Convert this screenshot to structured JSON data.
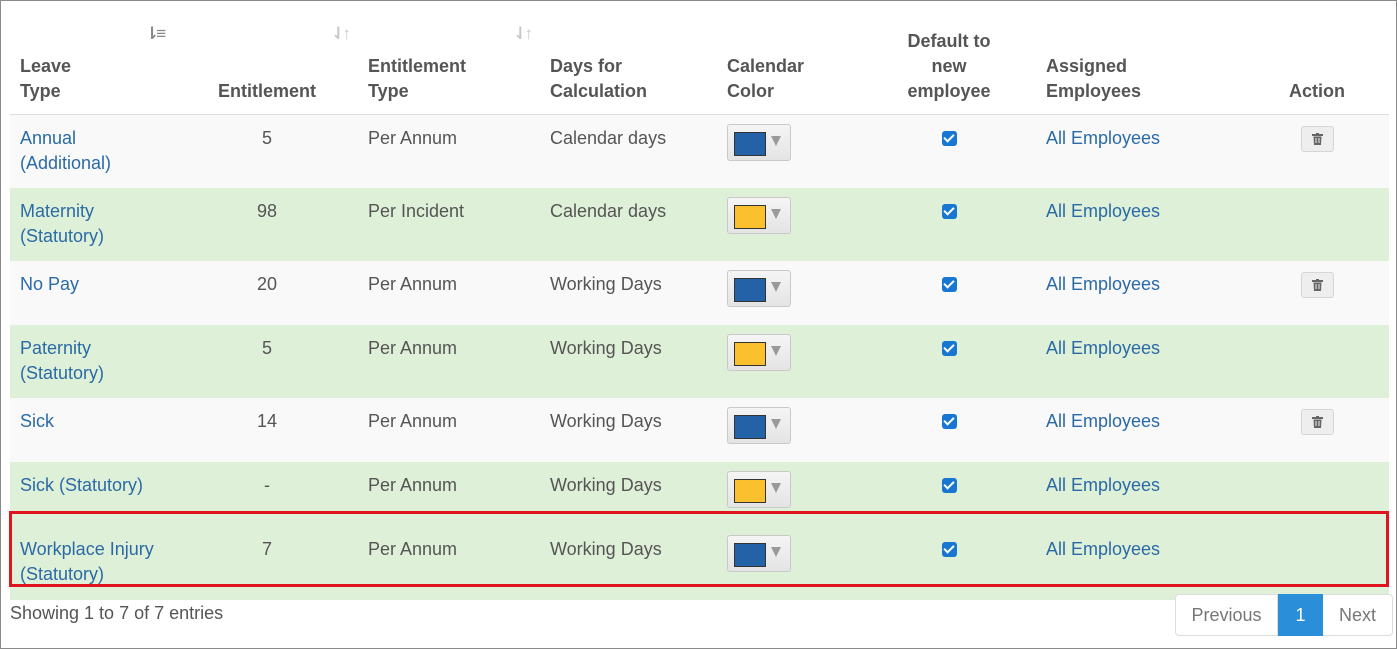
{
  "table": {
    "headers": {
      "leave_type": "Leave Type",
      "entitlement": "Entitlement",
      "entitlement_type": "Entitlement Type",
      "days_for_calculation": "Days for Calculation",
      "calendar_color": "Calendar Color",
      "default_to_new_employee": "Default to new employee",
      "assigned_employees": "Assigned Employees",
      "action": "Action"
    },
    "rows": [
      {
        "leave_type": "Annual (Additional)",
        "entitlement": "5",
        "entitlement_type": "Per Annum",
        "days_for_calculation": "Calendar days",
        "calendar_color": "#2462a8",
        "default_checked": true,
        "assigned_employees": "All Employees",
        "has_delete": true
      },
      {
        "leave_type": "Maternity (Statutory)",
        "entitlement": "98",
        "entitlement_type": "Per Incident",
        "days_for_calculation": "Calendar days",
        "calendar_color": "#fbc02d",
        "default_checked": true,
        "assigned_employees": "All Employees",
        "has_delete": false
      },
      {
        "leave_type": "No Pay",
        "entitlement": "20",
        "entitlement_type": "Per Annum",
        "days_for_calculation": "Working Days",
        "calendar_color": "#2462a8",
        "default_checked": true,
        "assigned_employees": "All Employees",
        "has_delete": true
      },
      {
        "leave_type": "Paternity (Statutory)",
        "entitlement": "5",
        "entitlement_type": "Per Annum",
        "days_for_calculation": "Working Days",
        "calendar_color": "#fbc02d",
        "default_checked": true,
        "assigned_employees": "All Employees",
        "has_delete": false
      },
      {
        "leave_type": "Sick",
        "entitlement": "14",
        "entitlement_type": "Per Annum",
        "days_for_calculation": "Working Days",
        "calendar_color": "#2462a8",
        "default_checked": true,
        "assigned_employees": "All Employees",
        "has_delete": true
      },
      {
        "leave_type": "Sick (Statutory)",
        "entitlement": "-",
        "entitlement_type": "Per Annum",
        "days_for_calculation": "Working Days",
        "calendar_color": "#fbc02d",
        "default_checked": true,
        "assigned_employees": "All Employees",
        "has_delete": false
      },
      {
        "leave_type": "Workplace Injury (Statutory)",
        "entitlement": "7",
        "entitlement_type": "Per Annum",
        "days_for_calculation": "Working Days",
        "calendar_color": "#2462a8",
        "default_checked": true,
        "assigned_employees": "All Employees",
        "has_delete": false
      }
    ]
  },
  "footer": {
    "info": "Showing 1 to 7 of 7 entries",
    "pagination": {
      "previous": "Previous",
      "current_page": "1",
      "next": "Next"
    }
  },
  "colors": {
    "link": "#2a6aa6",
    "row_green": "#dff0d8",
    "row_light": "#f9f9f9",
    "highlight_border": "#e0141e",
    "pagination_active": "#2b8ed8",
    "checkbox": "#1877d2"
  },
  "icons": {
    "sort_active": "sort-amount-down-icon",
    "sort": "sort-arrows-icon",
    "delete": "trash-icon",
    "dropdown": "caret-down-icon",
    "checkbox": "checkmark-icon"
  }
}
